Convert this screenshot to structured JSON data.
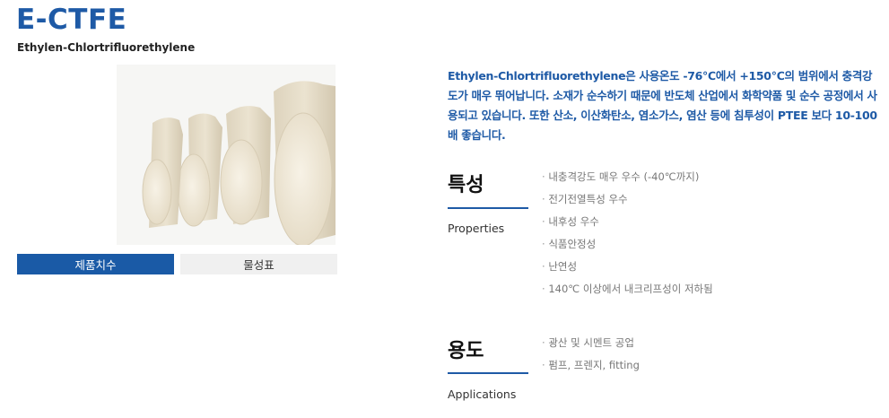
{
  "product": {
    "title": "E-CTFE",
    "subtitle": "Ethylen-Chlortrifluorethylene"
  },
  "tabs": [
    {
      "label": "제품치수",
      "active": true
    },
    {
      "label": "물성표",
      "active": false
    }
  ],
  "description": "Ethylen-Chlortrifluorethylene은 사용온도 -76℃에서 +150℃의 범위에서 충격강도가 매우 뛰어납니다. 소재가 순수하기 때문에 반도체 산업에서 화학약품 및 순수 공정에서 사용되고 있습니다. 또한 산소, 이산화탄소, 염소가스, 염산 등에 침투성이 PTEE 보다 10-100배 좋습니다.",
  "properties": {
    "title": "특성",
    "subtitle": "Properties",
    "items": [
      "내충격강도 매우 우수 (-40℃까지)",
      "전기전열특성 우수",
      "내후성 우수",
      "식품안정성",
      "난연성",
      "140℃ 이상에서 내크리프성이 저하됨"
    ]
  },
  "applications": {
    "title": "용도",
    "subtitle": "Applications",
    "items": [
      "광산 및 시멘트 공업",
      "펌프, 프렌지, fitting"
    ]
  },
  "colors": {
    "accent": "#1e5aa6",
    "tab_active": "#1a5aa6",
    "tab_inactive": "#f0f0f0"
  }
}
